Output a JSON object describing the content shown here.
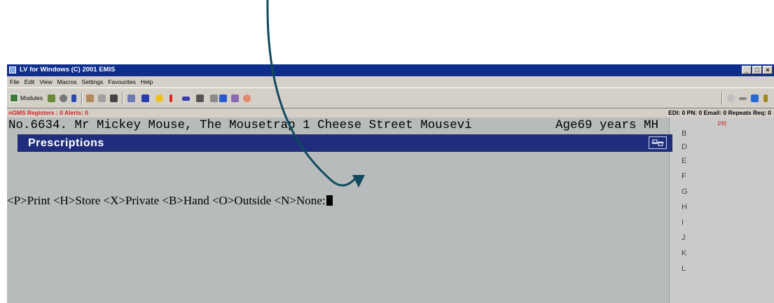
{
  "window": {
    "title": "LV for Windows (C) 2001 EMIS",
    "buttons": [
      "_",
      "□",
      "×"
    ]
  },
  "menu": [
    "File",
    "Edit",
    "View",
    "Macros",
    "Settings",
    "Favourites",
    "Help"
  ],
  "toolbar": {
    "modules_label": "Modules"
  },
  "status": {
    "left": "nGMS Registers : 0  Alerts: 0",
    "right": "EDI: 0  PN: 0  Email: 0  Repeats Req: 0"
  },
  "patient": {
    "header": "No.6634. Mr Mickey Mouse, The Mousetrap 1 Cheese Street Mousevi",
    "age": "Age69 years MH"
  },
  "side": {
    "label": "PR",
    "letters": [
      "B",
      "D",
      "E",
      "F",
      "G",
      "H",
      "I",
      "J",
      "K",
      "L"
    ]
  },
  "screen": {
    "title": "Prescriptions",
    "prompt": "<P>Print <H>Store <X>Private <B>Hand <O>Outside <N>None:"
  },
  "colors": {
    "title_bar": "#0d2e8c",
    "prescriptions_bar": "#1f2d7c",
    "background": "#b7bbbb",
    "alert": "#d02020",
    "arrow": "#0f4a5e"
  }
}
